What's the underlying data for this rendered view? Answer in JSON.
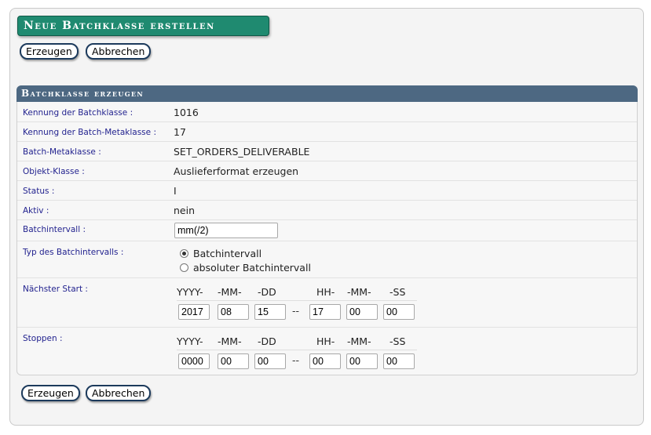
{
  "page_title": "Neue Batchklasse erstellen",
  "buttons": {
    "create": "Erzeugen",
    "cancel": "Abbrechen"
  },
  "panel": {
    "title": "Batchklasse erzeugen",
    "fields": {
      "batch_id": {
        "label": "Kennung der Batchklasse",
        "value": "1016"
      },
      "meta_id": {
        "label": "Kennung der Batch-Metaklasse",
        "value": "17"
      },
      "meta_class": {
        "label": "Batch-Metaklasse",
        "value": "SET_ORDERS_DELIVERABLE"
      },
      "object_class": {
        "label": "Objekt-Klasse",
        "value": "Auslieferformat erzeugen"
      },
      "status": {
        "label": "Status",
        "value": "I"
      },
      "active": {
        "label": "Aktiv",
        "value": "nein"
      },
      "interval": {
        "label": "Batchintervall",
        "value": "mm(/2)"
      },
      "interval_type": {
        "label": "Typ des Batchintervalls",
        "options": [
          "Batchintervall",
          "absoluter Batchintervall"
        ],
        "selected": "Batchintervall"
      },
      "next_start": {
        "label": "Nächster Start",
        "headers": [
          "YYYY-",
          "-MM-",
          "-DD",
          "HH-",
          "-MM-",
          "-SS"
        ],
        "values": [
          "2017",
          "08",
          "15",
          "17",
          "00",
          "00"
        ]
      },
      "stop": {
        "label": "Stoppen",
        "headers": [
          "YYYY-",
          "-MM-",
          "-DD",
          "HH-",
          "-MM-",
          "-SS"
        ],
        "values": [
          "0000",
          "00",
          "00",
          "00",
          "00",
          "00"
        ]
      }
    },
    "separator": "--",
    "colon": ":"
  }
}
